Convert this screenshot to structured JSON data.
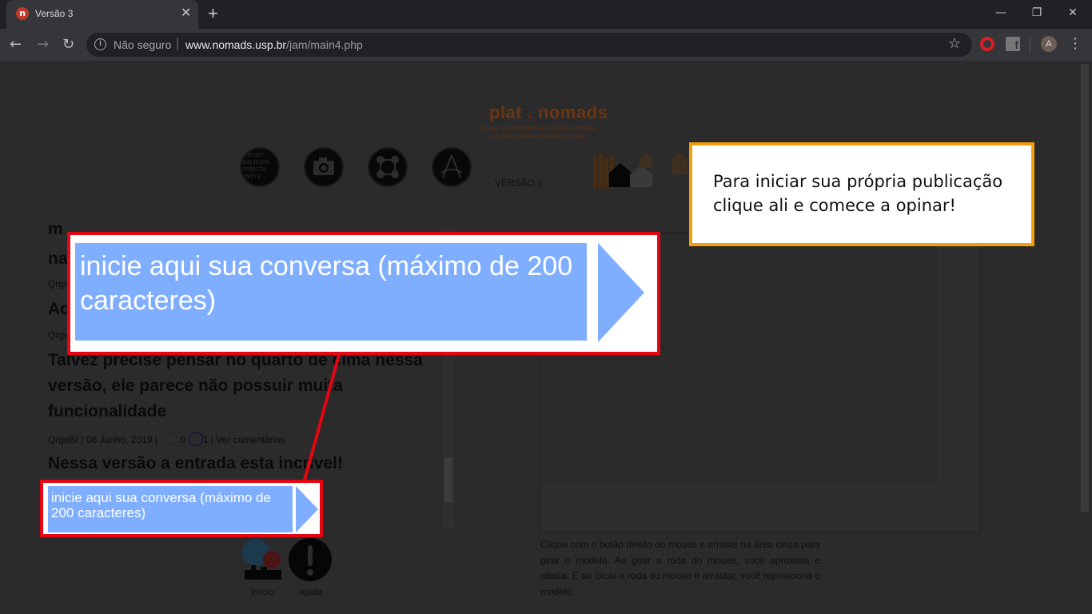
{
  "browser": {
    "tab_title": "Versão 3",
    "tab_favicon": "n",
    "new_tab_glyph": "+",
    "close_glyph": "✕",
    "security_label": "Não seguro",
    "url_domain": "www.nomads.usp.br",
    "url_path": "/jam/main4.php",
    "avatar_letter": "A"
  },
  "header": {
    "logo_word1": "plat",
    "logo_dot": " . ",
    "logo_word2": "nomads",
    "logo_tagline_1": "espaço participativo em projetos urbanos",
    "logo_tagline_2": "por transparência e pertencimento",
    "version_label": "VERSÃO 1"
  },
  "posts": [
    {
      "title": "na",
      "meta": ""
    },
    {
      "title": "Ac",
      "meta": ""
    },
    {
      "title": "Talvez precise pensar no quarto de cima nessa versão, ele parece não possuir muita funcionalidade",
      "meta": "QrgeBI | 06 Junho, 2019 |",
      "likes": "0",
      "dislikes": "1",
      "comments_link": "Ver comentários"
    },
    {
      "title": "Nessa versão a entrada esta incrível!",
      "meta": ""
    }
  ],
  "post_meta_fragments": [
    "Qrge",
    "Qrge"
  ],
  "conversation": {
    "placeholder": "inicie aqui sua conversa (máximo de 200 caracteres)"
  },
  "viewer": {
    "help_text": "Clique com o botão direito do mouse e arraste na área cinza para girar o modelo. Ao girar a roda do mouse, você aproxima e afasta. E ao clicar a roda do mouse e arrastar, você reposiciona o modelo."
  },
  "bottom_nav": {
    "home_label": "início",
    "help_label": "ajuda"
  },
  "callout": {
    "text": "Para iniciar sua própria publicação clique ali e comece a opinar!"
  },
  "colors": {
    "highlight_border": "#e30613",
    "callout_border": "#f59e0b",
    "input_fill": "#80aeff"
  }
}
